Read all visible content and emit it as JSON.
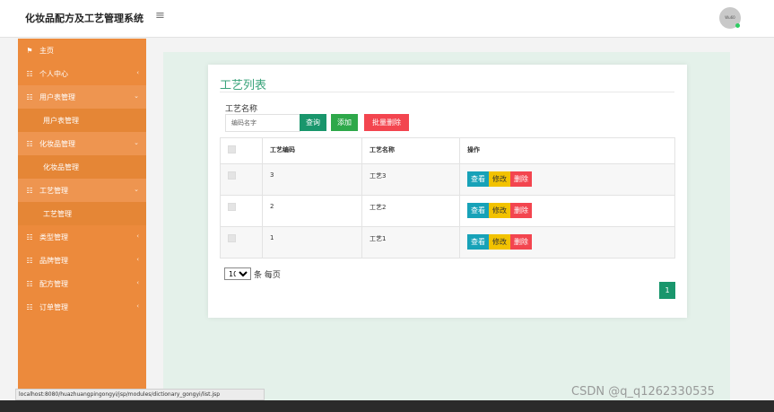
{
  "app": {
    "title": "化妆品配方及工艺管理系统",
    "avatar_text": "Wu60"
  },
  "sidebar": {
    "items": [
      {
        "label": "主页"
      },
      {
        "label": "个人中心"
      },
      {
        "label": "用户表管理"
      },
      {
        "label": "用户表管理"
      },
      {
        "label": "化妆品管理"
      },
      {
        "label": "化妆品管理"
      },
      {
        "label": "工艺管理"
      },
      {
        "label": "工艺管理"
      },
      {
        "label": "类型管理"
      },
      {
        "label": "品牌管理"
      },
      {
        "label": "配方管理"
      },
      {
        "label": "订单管理"
      }
    ]
  },
  "panel": {
    "title": "工艺列表",
    "filter_label": "工艺名称",
    "search_placeholder": "编码名字",
    "buttons": {
      "query": "查询",
      "add": "添加",
      "batch_delete": "批量删除"
    }
  },
  "table": {
    "headers": [
      "工艺编码",
      "工艺名称",
      "操作"
    ],
    "rows": [
      {
        "code": "3",
        "name": "工艺3"
      },
      {
        "code": "2",
        "name": "工艺2"
      },
      {
        "code": "1",
        "name": "工艺1"
      }
    ],
    "actions": {
      "view": "查看",
      "edit": "修改",
      "delete": "删除"
    }
  },
  "pagination": {
    "page_size": "10",
    "per_page_label": "条 每页",
    "current_page": "1"
  },
  "status_url": "localhost:8080/huazhuangpingongyi/jsp/modules/dictionary_gongyi/list.jsp",
  "watermark": "CSDN @q_q1262330535"
}
